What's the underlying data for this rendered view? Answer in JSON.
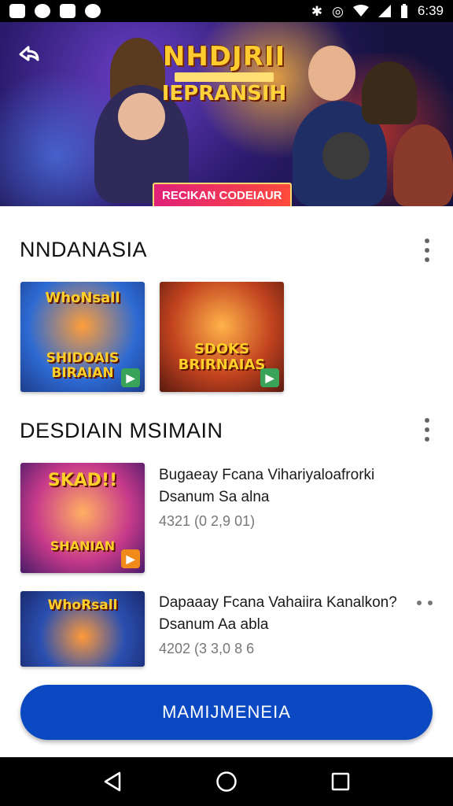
{
  "status_bar": {
    "time": "6:39",
    "left_icons": [
      "notification-icon",
      "settings-icon",
      "app-icon",
      "whatsapp-icon"
    ],
    "right_icons": [
      "bluetooth-icon",
      "alarm-icon",
      "wifi-icon",
      "signal-icon",
      "battery-icon"
    ]
  },
  "hero": {
    "title": "NHDJRII",
    "subtitle": "IEPRANSIH",
    "cta_label": "RECIKAN CODEIAUR",
    "back_icon": "back-arrow-icon"
  },
  "section1": {
    "title": "NNDANASIA",
    "thumbnails": [
      {
        "top_text": "WhoNsall",
        "bottom_text": "SHIDOAIS BIRAIAN"
      },
      {
        "top_text": "",
        "bottom_text": "SDOKS BRIRNAIAS"
      }
    ]
  },
  "section2": {
    "title": "DESDIAIN MSIMAIN",
    "items": [
      {
        "thumb_top": "SKAD!!",
        "thumb_bottom": "SHANIAN",
        "title": "Bugaeay Fcana Vihariyaloafrorki",
        "subtitle": "Dsanum Sa alna",
        "meta": "4321 (0 2,9 01)"
      },
      {
        "thumb_top": "WhoRsall",
        "thumb_bottom": "",
        "title": "Dapaaay Fcana Vahaiira Kanalkon?",
        "subtitle": "Dsanum Aa abla",
        "meta": "4202 (3 3,0 8 6"
      }
    ]
  },
  "main_button": {
    "label": "MAMIJMENEIA"
  },
  "colors": {
    "accent": "#0a49c2",
    "status_bar": "#000000",
    "nav_bar": "#000000"
  },
  "nav_bar": {
    "icons": [
      "back-triangle-icon",
      "home-circle-icon",
      "recents-square-icon"
    ]
  }
}
